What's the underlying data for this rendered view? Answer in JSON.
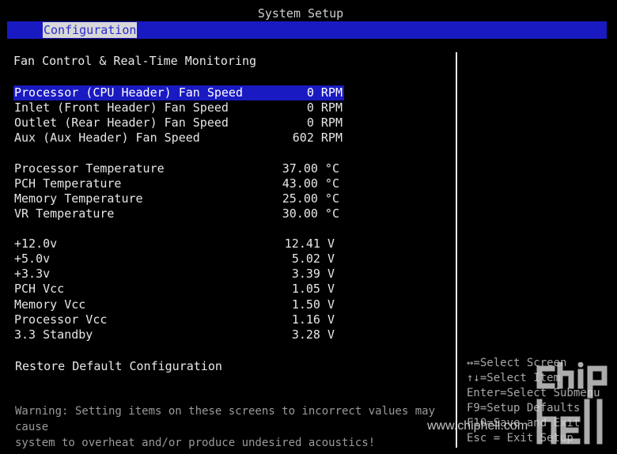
{
  "header": {
    "title": "System Setup"
  },
  "menubar": {
    "active_tab": "Configuration"
  },
  "section": {
    "title": "Fan Control & Real-Time Monitoring"
  },
  "fans": [
    {
      "label": "Processor (CPU Header) Fan Speed",
      "value": "0 RPM",
      "selected": true
    },
    {
      "label": "Inlet (Front Header) Fan Speed",
      "value": "0 RPM"
    },
    {
      "label": "Outlet (Rear Header) Fan Speed",
      "value": "0 RPM"
    },
    {
      "label": "Aux (Aux Header) Fan Speed",
      "value": "602 RPM"
    }
  ],
  "temperatures": [
    {
      "label": "Processor Temperature",
      "value": "37.00 °C"
    },
    {
      "label": "PCH Temperature",
      "value": "43.00 °C"
    },
    {
      "label": "Memory Temperature",
      "value": "25.00 °C"
    },
    {
      "label": "VR Temperature",
      "value": "30.00 °C"
    }
  ],
  "voltages": [
    {
      "label": "+12.0v",
      "value": "12.41 V"
    },
    {
      "label": "+5.0v",
      "value": "5.02 V"
    },
    {
      "label": "+3.3v",
      "value": "3.39 V"
    },
    {
      "label": "PCH Vcc",
      "value": "1.05 V"
    },
    {
      "label": "Memory Vcc",
      "value": "1.50 V"
    },
    {
      "label": "Processor Vcc",
      "value": "1.16 V"
    },
    {
      "label": "3.3 Standby",
      "value": "3.28 V"
    }
  ],
  "restore_default": "Restore Default Configuration",
  "warning": "Warning: Setting items on these screens to incorrect values may cause\nsystem to overheat and/or produce undesired acoustics!",
  "help": [
    "↔=Select Screen",
    "↑↓=Select Item",
    "Enter=Select Submenu",
    "F9=Setup Defaults",
    "F10=Save and Exit",
    "Esc = Exit Setup"
  ],
  "watermark": {
    "site": "www.chiphell.com",
    "logo_text": "chip hell"
  },
  "colors": {
    "menubar": "#1a1ac2",
    "selected_row": "#1a1ac2",
    "background": "#000000"
  }
}
